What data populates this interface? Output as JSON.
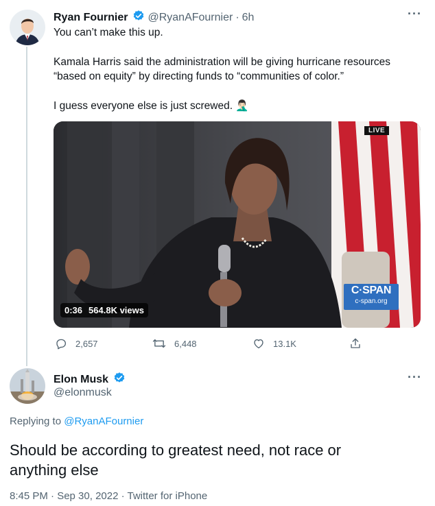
{
  "tweet": {
    "author_name": "Ryan Fournier",
    "author_handle": "@RyanAFournier",
    "separator": "·",
    "time": "6h",
    "more": "···",
    "paragraphs": [
      "You can’t make this up.",
      "Kamala Harris said the administration will be giving hurricane resources",
      "“based on equity” by directing funds to “communities of color.”",
      "I guess everyone else is just screwed. 🤦🏻‍♂️"
    ],
    "media": {
      "live_label": "LIVE",
      "brand_label": "C·SPAN",
      "brand_url": "c-span.org",
      "duration": "0:36",
      "views": "564.8K views"
    },
    "actions": {
      "replies": "2,657",
      "retweets": "6,448",
      "likes": "13.1K"
    }
  },
  "reply": {
    "author_name": "Elon Musk",
    "author_handle": "@elonmusk",
    "more": "···",
    "replying_prefix": "Replying to",
    "replying_to": "@RyanAFournier",
    "text_line1": "Should be according to greatest need, not race or",
    "text_line2": "anything else",
    "timestamp": "8:45 PM · Sep 30, 2022 · Twitter for iPhone"
  },
  "colors": {
    "accent": "#1d9bf0",
    "muted": "#536471",
    "text": "#0f1419",
    "thread_line": "#cfd9de"
  },
  "icons": [
    "verified-badge-icon",
    "more-options-icon",
    "reply-icon",
    "retweet-icon",
    "like-icon",
    "share-icon"
  ]
}
